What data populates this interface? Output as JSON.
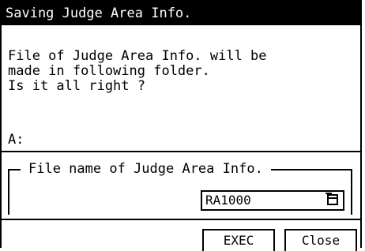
{
  "dialog": {
    "title": "Saving Judge Area Info.",
    "message_lines": [
      "File of Judge Area Info. will be",
      "made in following folder.",
      "Is it all right ?"
    ],
    "folder_label": "A:",
    "group_label": "File name of Judge Area Info.",
    "filename_value": "RA1000",
    "exec_label": "EXEC",
    "close_label": "Close"
  }
}
